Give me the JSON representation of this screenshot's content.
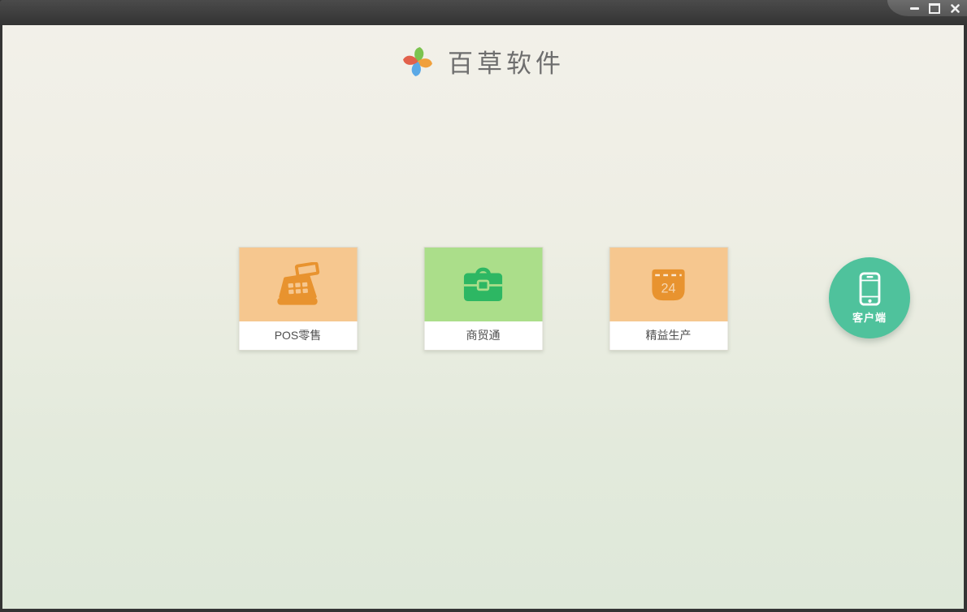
{
  "window": {
    "titlebar": {
      "controls": [
        {
          "icon": "minimize-icon"
        },
        {
          "icon": "maximize-icon"
        },
        {
          "icon": "close-icon"
        }
      ]
    }
  },
  "brand": {
    "title": "百草软件",
    "logo_icon": "pinwheel-logo-icon",
    "logo_colors": {
      "top": "#7cc34e",
      "right": "#f0a03c",
      "bottom": "#5ba9e6",
      "left": "#e2614b"
    }
  },
  "products": [
    {
      "label": "POS零售",
      "icon": "cash-register-icon",
      "tile_bg": "#f6c78f",
      "icon_color": "#e8932f"
    },
    {
      "label": "商贸通",
      "icon": "briefcase-icon",
      "tile_bg": "#abde8a",
      "icon_color": "#2db763"
    },
    {
      "label": "精益生产",
      "icon": "calendar-icon",
      "tile_bg": "#f6c78f",
      "icon_color": "#e8932f",
      "calendar_day": "24"
    }
  ],
  "client_button": {
    "label": "客户端",
    "icon": "smartphone-icon",
    "bg": "#4fc29c"
  },
  "theme": {
    "bg_top": "#f2f0e9",
    "bg_bottom": "#dee8d9",
    "titlebar": "#3a3a3a",
    "label_color": "#4f4f4f"
  }
}
